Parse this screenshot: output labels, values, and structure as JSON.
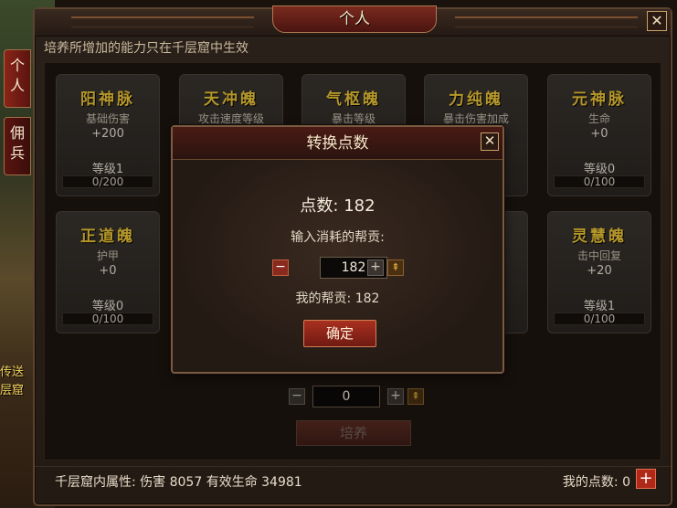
{
  "window": {
    "title": "个人",
    "close": "✕",
    "hint": "培养所增加的能力只在千层窟中生效"
  },
  "tabs": [
    {
      "label": "个人"
    },
    {
      "label": "佣兵"
    }
  ],
  "background": {
    "text_line1": "传送",
    "text_line2": "层窟"
  },
  "cards": [
    {
      "name": "阳神脉",
      "stat": "基础伤害",
      "bonus": "+200",
      "level": "等级1",
      "progress": "0/200"
    },
    {
      "name": "天冲魄",
      "stat": "攻击速度等级"
    },
    {
      "name": "气枢魄",
      "stat": "暴击等级"
    },
    {
      "name": "力纯魄",
      "stat": "暴击伤害加成"
    },
    {
      "name": "元神脉",
      "stat": "生命",
      "bonus": "+0",
      "level": "等级0",
      "progress": "0/100"
    },
    {
      "name": "正道魄",
      "stat": "护甲",
      "bonus": "+0",
      "level": "等级0",
      "progress": "0/100"
    },
    {
      "name": "灵慧魄",
      "stat": "击中回复",
      "bonus": "+20",
      "level": "等级1",
      "progress": "0/100"
    }
  ],
  "training": {
    "minus": "−",
    "value": "0",
    "plus": "+",
    "max": "⇞",
    "train_label": "培养"
  },
  "footer": {
    "attributes": "千层窟内属性: 伤害  8057  有效生命  34981",
    "my_points": "我的点数:  0",
    "plus": "+"
  },
  "modal": {
    "title": "转换点数",
    "close": "✕",
    "points": "点数: 182",
    "prompt": "输入消耗的帮贡:",
    "minus": "−",
    "value": "182",
    "plus": "+",
    "max": "⇞",
    "contribution": "我的帮贡: 182",
    "confirm": "确定"
  }
}
